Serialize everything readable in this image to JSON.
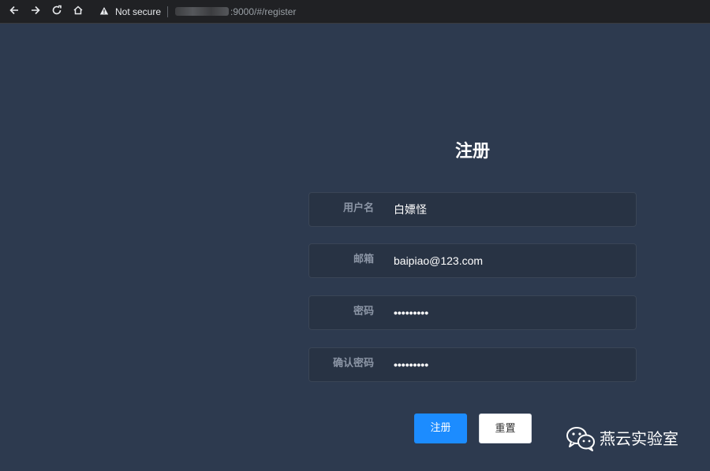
{
  "browser": {
    "security_label": "Not secure",
    "url_visible": ":9000/#/register"
  },
  "form": {
    "title": "注册",
    "fields": [
      {
        "label": "用户名",
        "value": "白嫖怪",
        "type": "text"
      },
      {
        "label": "邮箱",
        "value": "baipiao@123.com",
        "type": "text"
      },
      {
        "label": "密码",
        "value": "•••••••••",
        "type": "password"
      },
      {
        "label": "确认密码",
        "value": "•••••••••",
        "type": "password"
      }
    ],
    "submit_label": "注册",
    "reset_label": "重置"
  },
  "watermark": {
    "text": "燕云实验室",
    "icon": "wechat-icon"
  },
  "colors": {
    "background": "#2d3a4f",
    "field_bg": "#283344",
    "primary": "#1c8cff"
  }
}
